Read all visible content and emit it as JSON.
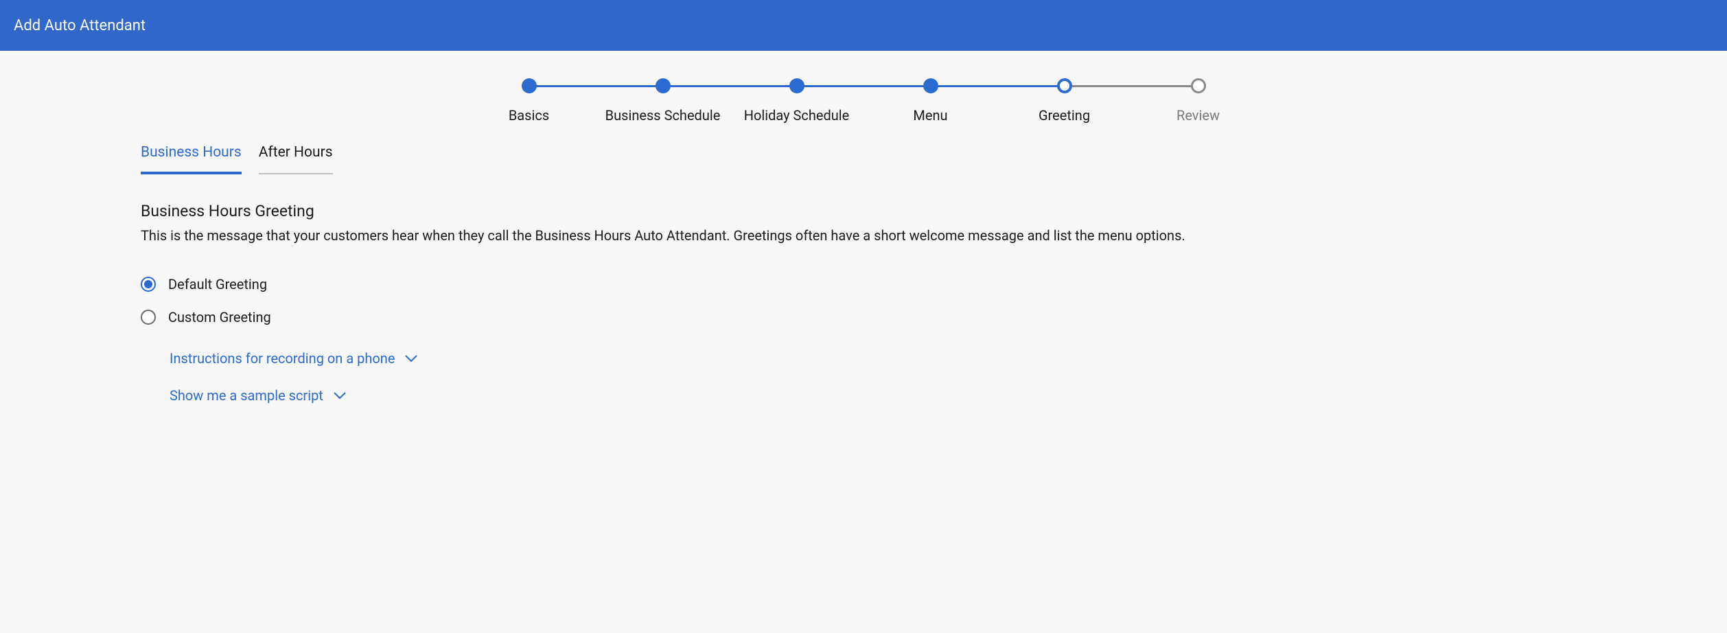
{
  "header": {
    "title": "Add Auto Attendant"
  },
  "stepper": {
    "steps": [
      {
        "label": "Basics",
        "state": "done"
      },
      {
        "label": "Business Schedule",
        "state": "done"
      },
      {
        "label": "Holiday Schedule",
        "state": "done"
      },
      {
        "label": "Menu",
        "state": "done"
      },
      {
        "label": "Greeting",
        "state": "current"
      },
      {
        "label": "Review",
        "state": "future"
      }
    ]
  },
  "tabs": [
    {
      "label": "Business Hours",
      "active": true
    },
    {
      "label": "After Hours",
      "active": false
    }
  ],
  "section": {
    "title": "Business Hours Greeting",
    "description": "This is the message that your customers hear when they call the Business Hours Auto Attendant. Greetings often have a short welcome message and list the menu options."
  },
  "greeting_options": [
    {
      "label": "Default Greeting",
      "selected": true
    },
    {
      "label": "Custom Greeting",
      "selected": false
    }
  ],
  "expandables": [
    {
      "label": "Instructions for recording on a phone"
    },
    {
      "label": "Show me a sample script"
    }
  ]
}
